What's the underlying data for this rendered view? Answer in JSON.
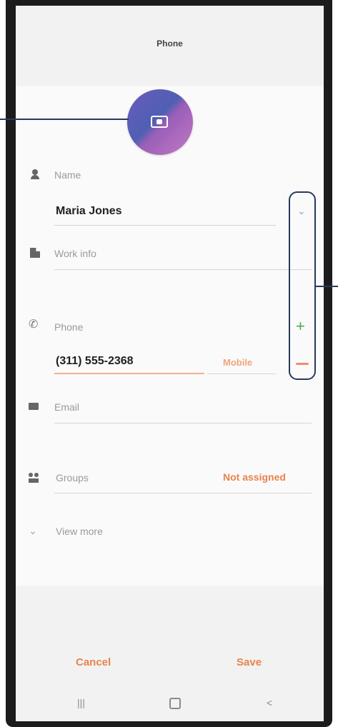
{
  "header": {
    "title": "Phone"
  },
  "contact": {
    "name_label": "Name",
    "name_value": "Maria Jones",
    "work_label": "Work info",
    "phone_label": "Phone",
    "phone_value": "(311) 555-2368",
    "phone_type": "Mobile",
    "email_label": "Email",
    "groups_label": "Groups",
    "groups_value": "Not assigned",
    "view_more_label": "View more"
  },
  "footer": {
    "cancel_label": "Cancel",
    "save_label": "Save"
  },
  "navbar": {
    "recents_glyph": "|||",
    "back_glyph": "<"
  },
  "icons": {
    "add": "+",
    "expand": "⌄",
    "view_more": "⌄"
  },
  "colors": {
    "accent": "#e8834a",
    "add_green": "#4caf50",
    "remove_red": "#f28b6b",
    "callout": "#263b59"
  }
}
